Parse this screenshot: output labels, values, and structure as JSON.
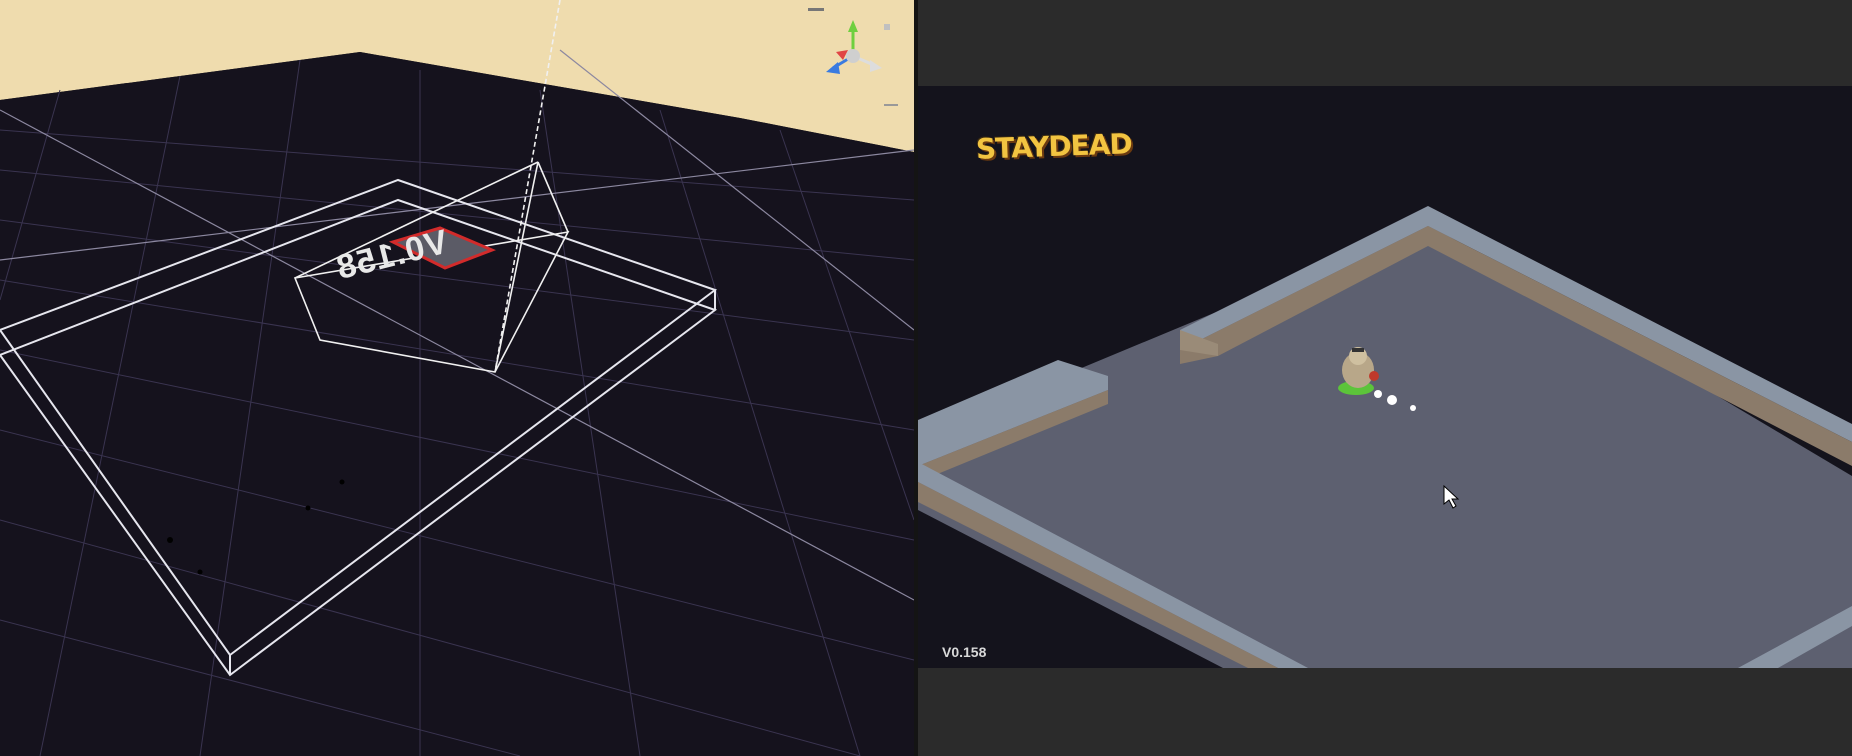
{
  "scene": {
    "mirrored_label": "V0.158"
  },
  "game": {
    "logo_text": "STAYDEAD",
    "version": "V0.158"
  },
  "colors": {
    "grid_floor": "#14121c",
    "sky": "#efdcae",
    "arena_floor": "#5d6070",
    "wall_top": "#8a95a4",
    "wall_side": "#8b7b6a",
    "logo": "#f2c441"
  }
}
